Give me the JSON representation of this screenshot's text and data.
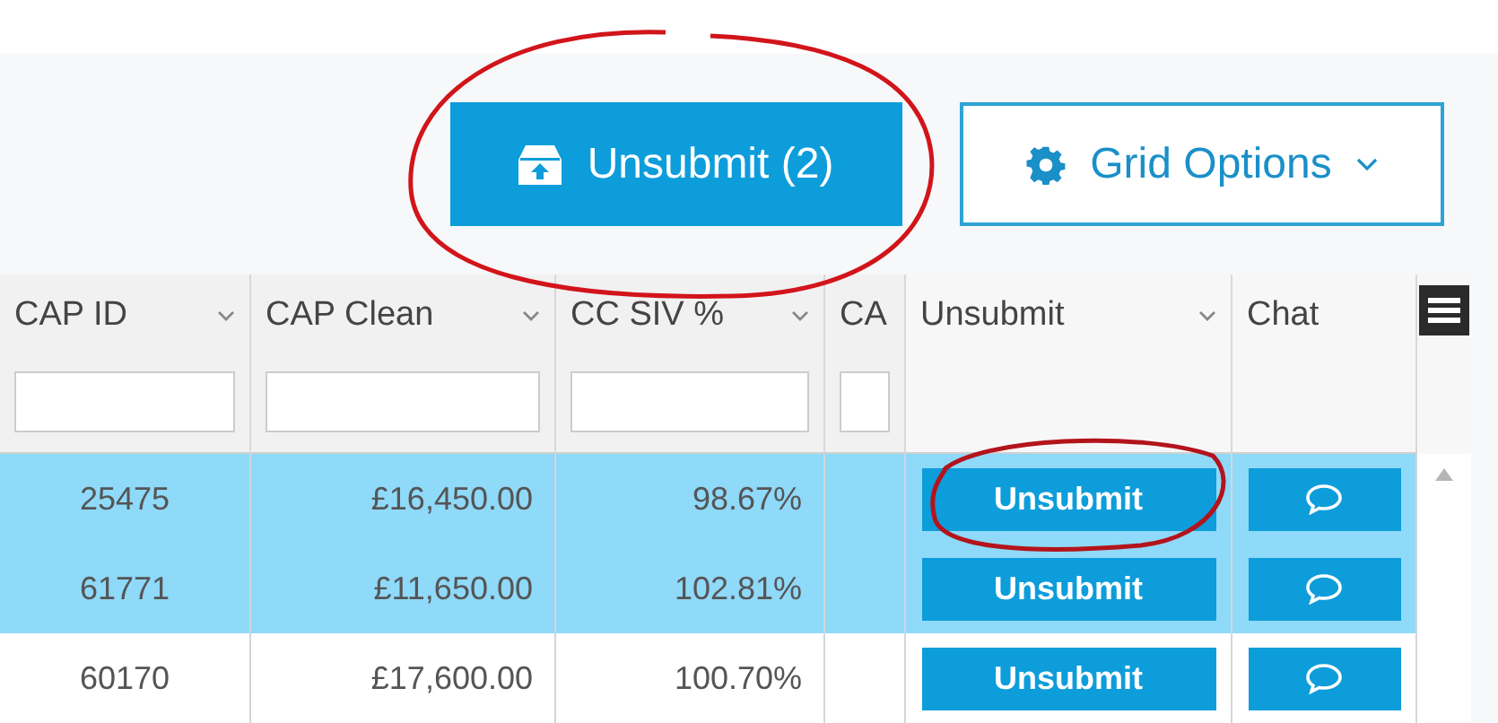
{
  "toolbar": {
    "buttons": [
      {
        "kind": "primary",
        "label": "Unsubmit (2)",
        "circled": true
      },
      {
        "kind": "outline",
        "label": "Grid Options",
        "circled": false
      }
    ]
  },
  "table": {
    "columns": [
      {
        "label": "CAP ID",
        "kind": "data"
      },
      {
        "label": "CAP Clean",
        "kind": "data"
      },
      {
        "label": "CC SIV %",
        "kind": "data"
      },
      {
        "label": "CA",
        "kind": "data"
      },
      {
        "label": "Unsubmit",
        "kind": "action"
      },
      {
        "label": "Chat",
        "kind": "action"
      }
    ],
    "rows": [
      {
        "cells": [
          "25475",
          "£16,450.00",
          "98.67%"
        ],
        "action": "Unsubmit",
        "selected": true,
        "circled": true
      },
      {
        "cells": [
          "61771",
          "£11,650.00",
          "102.81%"
        ],
        "action": "Unsubmit",
        "selected": true,
        "circled": false
      },
      {
        "cells": [
          "60170",
          "£17,600.00",
          "100.70%"
        ],
        "action": "Unsubmit",
        "selected": false,
        "circled": false
      }
    ]
  }
}
